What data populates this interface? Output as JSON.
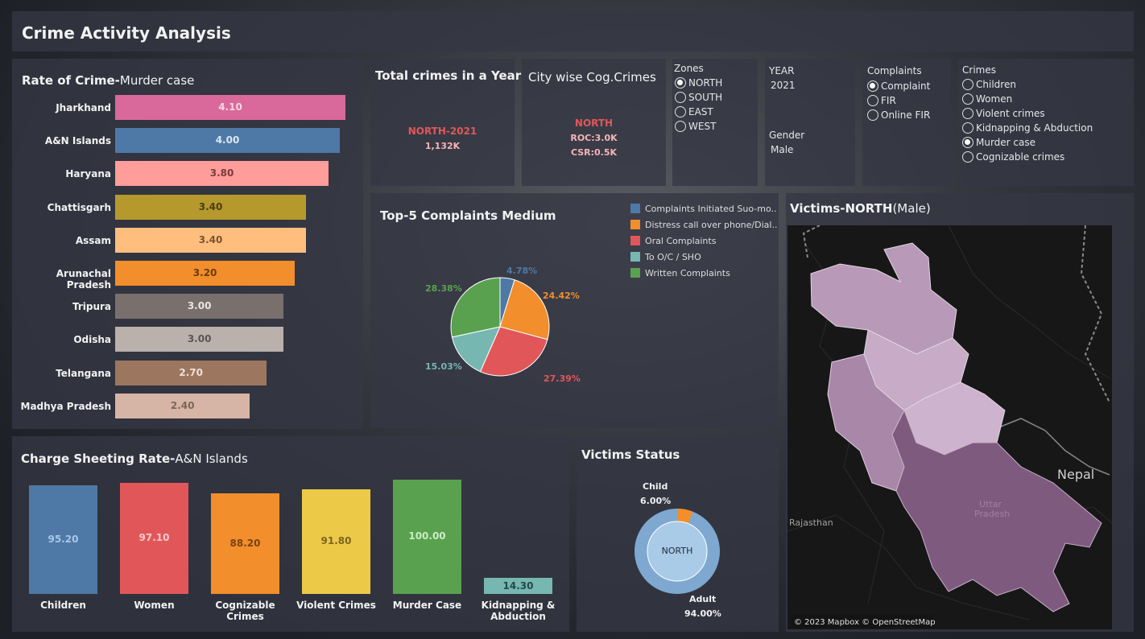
{
  "app": {
    "title": "Crime Activity Analysis"
  },
  "rate": {
    "title": "Rate of Crime-",
    "subtitle": "Murder case",
    "bars": [
      {
        "label": "Jharkhand",
        "value": "4.10",
        "num": 4.1,
        "color": "#d9699a",
        "text": "#f5d6e4"
      },
      {
        "label": "A&N Islands",
        "value": "4.00",
        "num": 4.0,
        "color": "#4e79a7",
        "text": "#dce6f2"
      },
      {
        "label": "Haryana",
        "value": "3.80",
        "num": 3.8,
        "color": "#ff9d9a",
        "text": "#7a3b3a"
      },
      {
        "label": "Chattisgarh",
        "value": "3.40",
        "num": 3.4,
        "color": "#b6992d",
        "text": "#4a3e10"
      },
      {
        "label": "Assam",
        "value": "3.40",
        "num": 3.4,
        "color": "#ffbe7d",
        "text": "#7a5530"
      },
      {
        "label": "Arunachal Pradesh",
        "value": "3.20",
        "num": 3.2,
        "color": "#f28e2b",
        "text": "#6b3a0c"
      },
      {
        "label": "Tripura",
        "value": "3.00",
        "num": 3.0,
        "color": "#79706e",
        "text": "#e8e4e3"
      },
      {
        "label": "Odisha",
        "value": "3.00",
        "num": 3.0,
        "color": "#bab0ac",
        "text": "#5c5553"
      },
      {
        "label": "Telangana",
        "value": "2.70",
        "num": 2.7,
        "color": "#9d7660",
        "text": "#f1e0d5"
      },
      {
        "label": "Madhya Pradesh",
        "value": "2.40",
        "num": 2.4,
        "color": "#d7b5a6",
        "text": "#7c655b"
      }
    ]
  },
  "total": {
    "title": "Total crimes in a Year",
    "line1": "NORTH-2021",
    "line2": "1,132K"
  },
  "city": {
    "title": "City wise Cog.Crimes",
    "line1": "NORTH",
    "line2": "ROC:3.0K",
    "line3": "CSR:0.5K"
  },
  "zones": {
    "title": "Zones",
    "options": [
      {
        "label": "NORTH",
        "on": true
      },
      {
        "label": "SOUTH",
        "on": false
      },
      {
        "label": "EAST",
        "on": false
      },
      {
        "label": "WEST",
        "on": false
      }
    ]
  },
  "year": {
    "title": "YEAR",
    "value": "2021",
    "gender_title": "Gender",
    "gender_value": "Male"
  },
  "complaints": {
    "title": "Complaints",
    "options": [
      {
        "label": "Complaint",
        "on": true
      },
      {
        "label": "FIR",
        "on": false
      },
      {
        "label": "Online FIR",
        "on": false
      }
    ]
  },
  "crimes": {
    "title": "Crimes",
    "options": [
      {
        "label": "Children",
        "on": false
      },
      {
        "label": "Women",
        "on": false
      },
      {
        "label": "Violent crimes",
        "on": false
      },
      {
        "label": "Kidnapping & Abduction",
        "on": false
      },
      {
        "label": "Murder case",
        "on": true
      },
      {
        "label": "Cognizable crimes",
        "on": false
      }
    ]
  },
  "top5": {
    "title": "Top-5 Complaints Medium",
    "legend": [
      {
        "label": "Complaints Initiated Suo-mo..",
        "color": "#4e79a7"
      },
      {
        "label": "Distress call over phone/Dial..",
        "color": "#f28e2b"
      },
      {
        "label": "Oral Complaints",
        "color": "#e15759"
      },
      {
        "label": "To O/C / SHO",
        "color": "#76b7b2"
      },
      {
        "label": "Written Complaints",
        "color": "#59a14f"
      }
    ]
  },
  "chart_data": {
    "type": "pie",
    "title": "Top-5 Complaints Medium",
    "slices": [
      {
        "label": "Complaints Initiated Suo-mo..",
        "value": 4.78,
        "text": "4.78%",
        "color": "#4e79a7"
      },
      {
        "label": "Distress call over phone/Dial..",
        "value": 24.42,
        "text": "24.42%",
        "color": "#f28e2b"
      },
      {
        "label": "Oral Complaints",
        "value": 27.39,
        "text": "27.39%",
        "color": "#e15759"
      },
      {
        "label": "To O/C / SHO",
        "value": 15.03,
        "text": "15.03%",
        "color": "#76b7b2"
      },
      {
        "label": "Written Complaints",
        "value": 28.38,
        "text": "28.38%",
        "color": "#59a14f"
      }
    ]
  },
  "charge": {
    "title": "Charge Sheeting Rate-",
    "subtitle": "A&N Islands",
    "bars": [
      {
        "label": "Children",
        "value": "95.20",
        "num": 95.2,
        "color": "#4e79a7",
        "text": "#a9c6e8"
      },
      {
        "label": "Women",
        "value": "97.10",
        "num": 97.1,
        "color": "#e15759",
        "text": "#f7c9c9"
      },
      {
        "label": "Cognizable Crimes",
        "value": "88.20",
        "num": 88.2,
        "color": "#f28e2b",
        "text": "#7a4212"
      },
      {
        "label": "Violent Crimes",
        "value": "91.80",
        "num": 91.8,
        "color": "#edc948",
        "text": "#7a6620"
      },
      {
        "label": "Murder Case",
        "value": "100.00",
        "num": 100.0,
        "color": "#59a14f",
        "text": "#c9ecc2"
      },
      {
        "label": "Kidnapping & Abduction",
        "value": "14.30",
        "num": 14.3,
        "color": "#76b7b2",
        "text": "#234a47"
      }
    ]
  },
  "victims": {
    "title": "Victims Status",
    "center": "NORTH",
    "child_label": "Child",
    "child_value": "6.00%",
    "child_pct": 6.0,
    "adult_label": "Adult",
    "adult_value": "94.00%",
    "adult_pct": 94.0,
    "adult_color": "#7ea8d0",
    "child_color": "#f28e2b"
  },
  "map": {
    "title": "Victims-NORTH",
    "subtitle": "(Male)",
    "labels": {
      "nepal": "Nepal",
      "rajasthan": "Rajasthan",
      "up1": "Uttar",
      "up2": "Pradesh"
    },
    "attribution": "© 2023 Mapbox © OpenStreetMap"
  }
}
